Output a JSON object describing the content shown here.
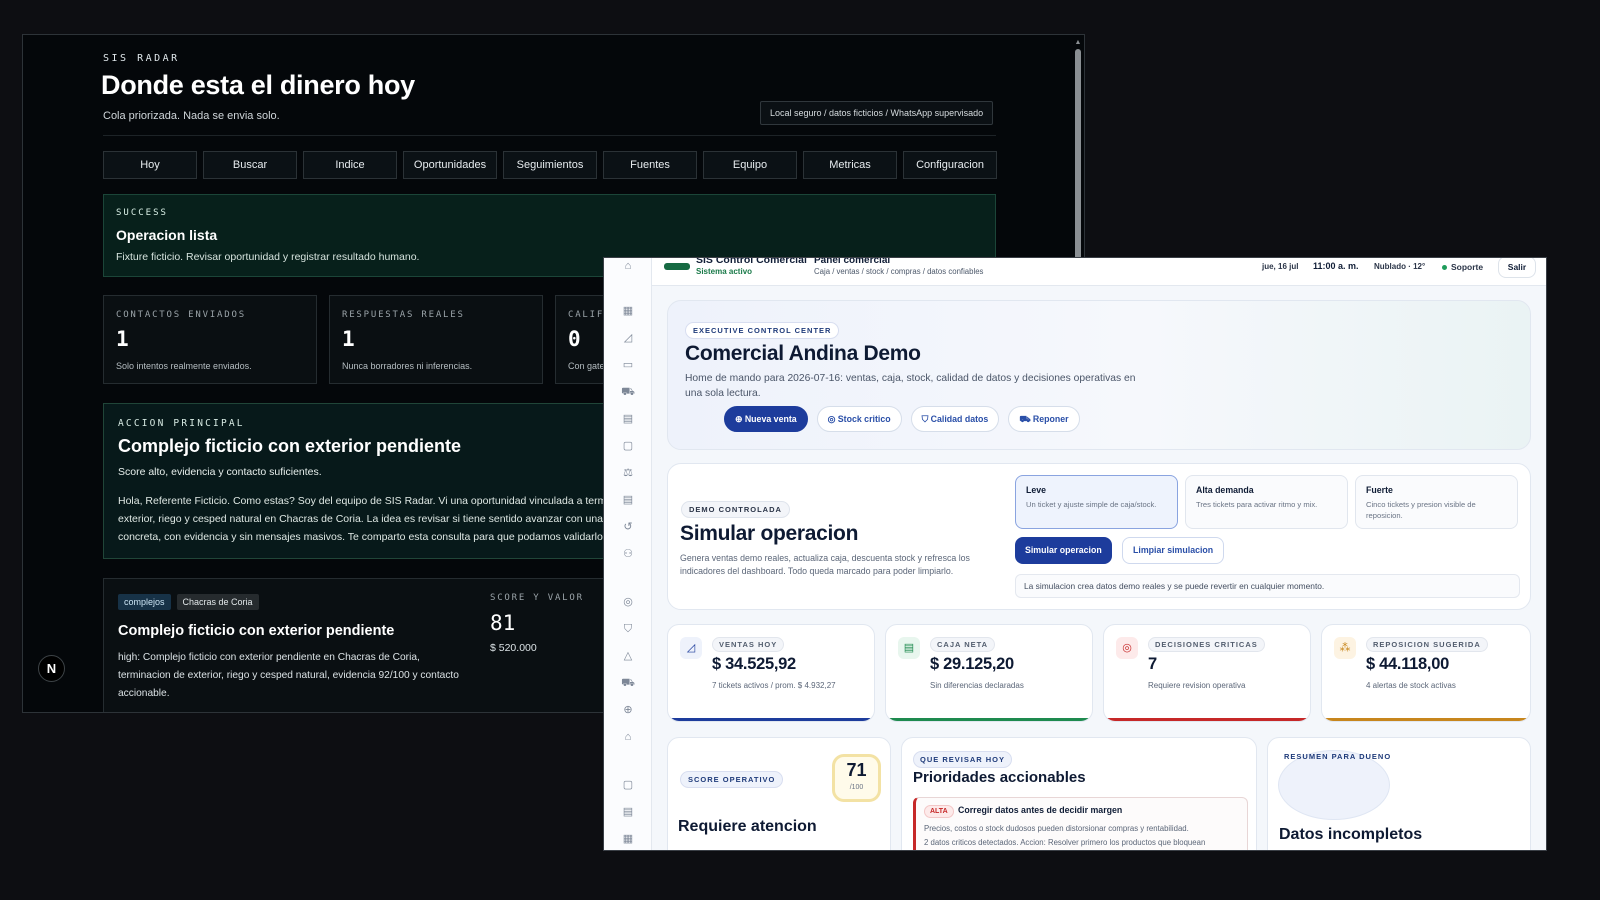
{
  "radar": {
    "eyebrow": "SIS RADAR",
    "title": "Donde esta el dinero hoy",
    "subtitle": "Cola priorizada. Nada se envia solo.",
    "chip": "Local seguro / datos ficticios / WhatsApp supervisado",
    "tabs": [
      "Hoy",
      "Buscar",
      "Indice",
      "Oportunidades",
      "Seguimientos",
      "Fuentes",
      "Equipo",
      "Metricas",
      "Configuracion"
    ],
    "success": {
      "label": "SUCCESS",
      "title": "Operacion lista",
      "text": "Fixture ficticio. Revisar oportunidad y registrar resultado humano."
    },
    "stats": [
      {
        "label": "CONTACTOS ENVIADOS",
        "value": "1",
        "note": "Solo intentos realmente enviados."
      },
      {
        "label": "RESPUESTAS REALES",
        "value": "1",
        "note": "Nunca borradores ni inferencias."
      },
      {
        "label": "CALIFI",
        "value": "0",
        "note": "Con gate"
      }
    ],
    "accion": {
      "label": "ACCION PRINCIPAL",
      "title": "Complejo ficticio con exterior pendiente",
      "subtitle": "Score alto, evidencia y contacto suficientes.",
      "message": [
        "Hola, Referente Ficticio. Como estas? Soy del equipo de SIS Radar. Vi una oportunidad vinculada a termi",
        "exterior, riego y cesped natural en Chacras de Coria. La idea es revisar si tiene sentido avanzar con una c",
        "concreta, con evidencia y sin mensajes masivos. Te comparto esta consulta para que podamos validarlo"
      ]
    },
    "card": {
      "tags": [
        "complejos",
        "Chacras de Coria"
      ],
      "title": "Complejo ficticio con exterior pendiente",
      "desc": [
        "high: Complejo ficticio con exterior pendiente en Chacras de Coria,",
        "terminacion de exterior, riego y cesped natural, evidencia 92/100 y contacto",
        "accionable."
      ],
      "score_label": "SCORE Y VALOR",
      "score": "81",
      "amount": "$ 520.000"
    },
    "badge": "N"
  },
  "control": {
    "brand": "SIS Control Comercial",
    "brand_status": "Sistema activo",
    "panel": "Panel comercial",
    "panel_sub": "Caja / ventas / stock / compras / datos confiables",
    "date": "jue, 16 jul",
    "time": "11:00 a. m.",
    "weather": "Nublado · 12°",
    "support": "Soporte",
    "exit": "Salir",
    "hero": {
      "eyebrow": "EXECUTIVE CONTROL CENTER",
      "title": "Comercial Andina Demo",
      "desc": [
        "Home de mando para 2026-07-16: ventas, caja, stock, calidad de datos y decisiones operativas en",
        "una sola lectura."
      ],
      "actions": [
        "Nueva venta",
        "Stock critico",
        "Calidad datos",
        "Reponer"
      ]
    },
    "sim": {
      "eyebrow": "DEMO CONTROLADA",
      "title": "Simular operacion",
      "desc": [
        "Genera ventas demo reales, actualiza caja, descuenta stock y refresca los",
        "indicadores del dashboard. Todo queda marcado para poder limpiarlo."
      ],
      "options": [
        {
          "name": "Leve",
          "desc": "Un ticket y ajuste simple de caja/stock."
        },
        {
          "name": "Alta demanda",
          "desc": "Tres tickets para activar ritmo y mix."
        },
        {
          "name": "Fuerte",
          "desc": "Cinco tickets y presion visible de reposicion."
        }
      ],
      "run": "Simular operacion",
      "clear": "Limpiar simulacion",
      "note": "La simulacion crea datos demo reales y se puede revertir en cualquier momento."
    },
    "kpis": [
      {
        "label": "VENTAS HOY",
        "value": "$ 34.525,92",
        "sub": "7 tickets activos / prom. $ 4.932,27",
        "color": "#1d3c9c",
        "bg": "#eef2fb",
        "fg": "#1d3c9c"
      },
      {
        "label": "CAJA NETA",
        "value": "$ 29.125,20",
        "sub": "Sin diferencias declaradas",
        "color": "#1e8a4f",
        "bg": "#e8f6ee",
        "fg": "#1e8a4f"
      },
      {
        "label": "DECISIONES CRITICAS",
        "value": "7",
        "sub": "Requiere revision operativa",
        "color": "#c62828",
        "bg": "#fdeaea",
        "fg": "#c62828"
      },
      {
        "label": "REPOSICION SUGERIDA",
        "value": "$ 44.118,00",
        "sub": "4 alertas de stock activas",
        "color": "#c7861d",
        "bg": "#fdf3e2",
        "fg": "#c7861d"
      }
    ],
    "score": {
      "eyebrow": "SCORE OPERATIVO",
      "value": "71",
      "of": "/100",
      "title": "Requiere atencion"
    },
    "prio": {
      "eyebrow": "QUE REVISAR HOY",
      "title": "Prioridades accionables",
      "pill": "ALTA",
      "item": "Corregir datos antes de decidir margen",
      "d1": "Precios, costos o stock dudosos pueden distorsionar compras y rentabilidad.",
      "d2": "2 datos criticos detectados. Accion: Resolver primero los productos que bloquean"
    },
    "owner": {
      "eyebrow": "RESUMEN PARA DUENO",
      "title": "Datos incompletos"
    }
  }
}
